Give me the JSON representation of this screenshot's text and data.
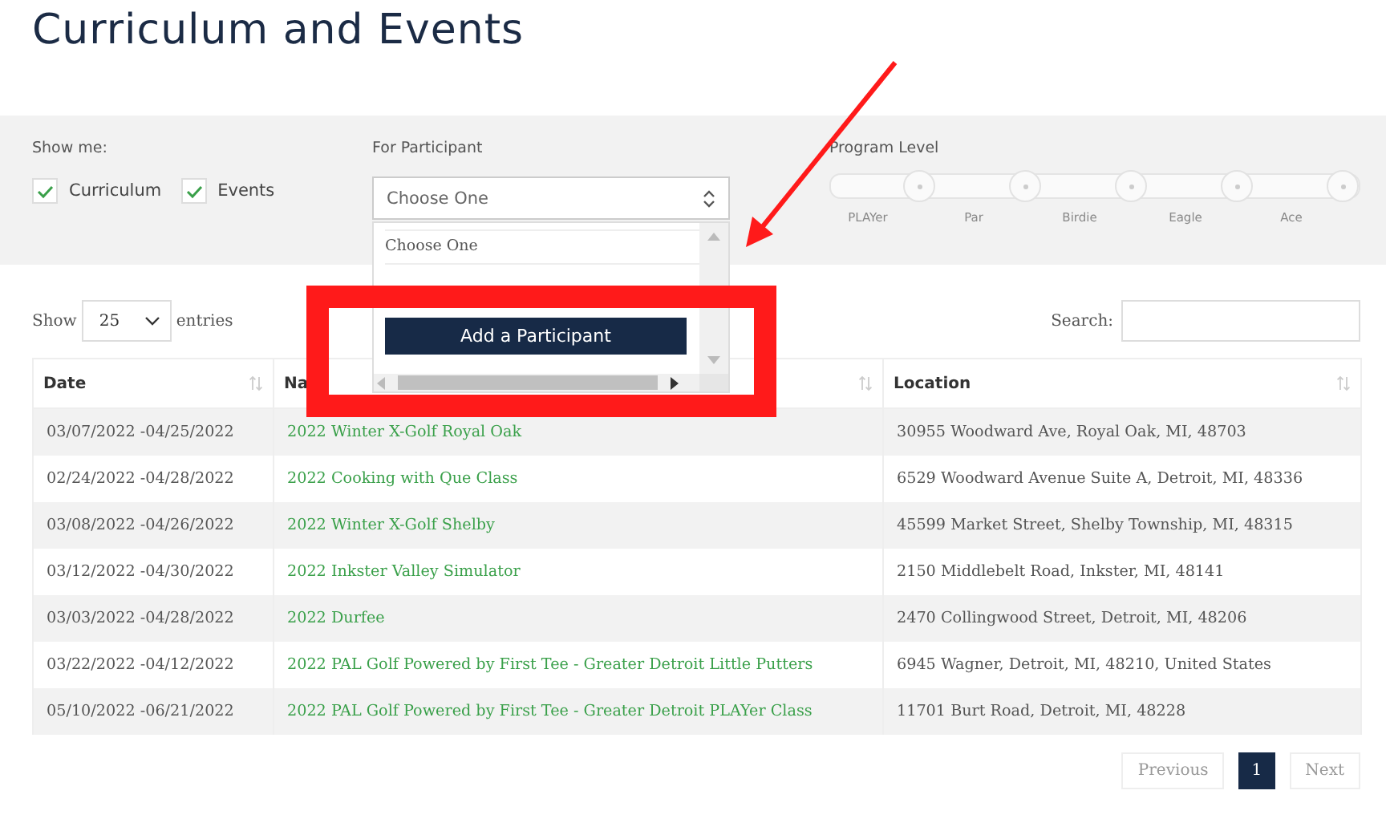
{
  "page_title": "Curriculum and Events",
  "filters": {
    "show_me": {
      "label": "Show me:",
      "options": [
        {
          "label": "Curriculum",
          "checked": true
        },
        {
          "label": "Events",
          "checked": true
        }
      ]
    },
    "participant": {
      "label": "For Participant",
      "value": "Choose One",
      "dropdown": {
        "options": [
          "Choose One"
        ],
        "action": "Add a Participant"
      }
    },
    "program_level": {
      "label": "Program Level",
      "stops": [
        {
          "label": "PLAYer",
          "selected": false
        },
        {
          "label": "Par",
          "selected": false
        },
        {
          "label": "Birdie",
          "selected": false
        },
        {
          "label": "Eagle",
          "selected": false
        },
        {
          "label": "Ace",
          "selected": false
        }
      ]
    }
  },
  "length_menu": {
    "before": "Show",
    "value": "25",
    "after": "entries"
  },
  "search": {
    "label": "Search:"
  },
  "table": {
    "columns": [
      "Date",
      "Na",
      "Location"
    ],
    "rows": [
      [
        "03/07/2022 -04/25/2022",
        "2022 Winter X-Golf Royal Oak",
        "30955 Woodward Ave, Royal Oak, MI, 48703"
      ],
      [
        "02/24/2022 -04/28/2022",
        "2022 Cooking with Que Class",
        "6529 Woodward Avenue Suite A, Detroit, MI, 48336"
      ],
      [
        "03/08/2022 -04/26/2022",
        "2022 Winter X-Golf Shelby",
        "45599 Market Street, Shelby Township, MI, 48315"
      ],
      [
        "03/12/2022 -04/30/2022",
        "2022 Inkster Valley Simulator",
        "2150 Middlebelt Road, Inkster, MI, 48141"
      ],
      [
        "03/03/2022 -04/28/2022",
        "2022 Durfee",
        "2470 Collingwood Street, Detroit, MI, 48206"
      ],
      [
        "03/22/2022 -04/12/2022",
        "2022 PAL Golf Powered by First Tee - Greater Detroit Little Putters",
        "6945 Wagner, Detroit, MI, 48210, United States"
      ],
      [
        "05/10/2022 -06/21/2022",
        "2022 PAL Golf Powered by First Tee - Greater Detroit PLAYer Class",
        "11701 Burt Road, Detroit, MI, 48228"
      ]
    ]
  },
  "pagination": {
    "previous": "Previous",
    "pages": [
      {
        "label": "1",
        "selected": true
      }
    ],
    "next": "Next"
  },
  "annotations": {
    "highlight_frame": true,
    "arrow": true
  }
}
